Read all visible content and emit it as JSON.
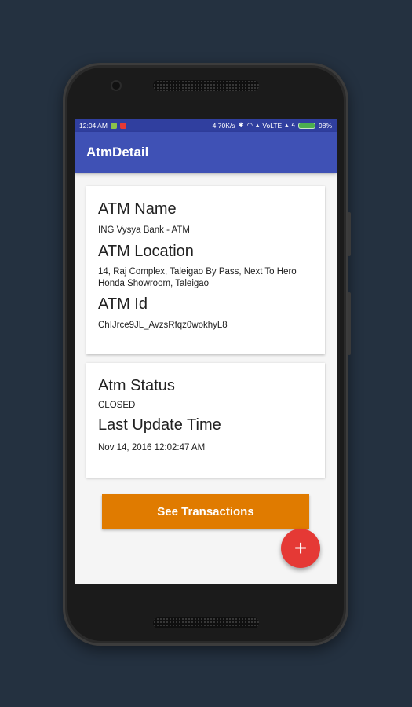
{
  "status_bar": {
    "time": "12:04 AM",
    "speed": "4.70K/s",
    "network": "VoLTE",
    "battery": "98%"
  },
  "app_bar": {
    "title": "AtmDetail"
  },
  "atm_card": {
    "name_heading": "ATM Name",
    "name_value": "ING Vysya Bank - ATM",
    "location_heading": "ATM Location",
    "location_value": "14, Raj Complex, Taleigao By Pass, Next To Hero Honda Showroom, Taleigao",
    "id_heading": "ATM Id",
    "id_value": "ChIJrce9JL_AvzsRfqz0wokhyL8"
  },
  "status_card": {
    "status_heading": "Atm Status",
    "status_value": "CLOSED",
    "update_heading": "Last Update Time",
    "update_value": "Nov 14, 2016 12:02:47 AM"
  },
  "actions": {
    "see_transactions_label": "See Transactions",
    "fab_label": "+"
  },
  "colors": {
    "primary": "#3f51b5",
    "primary_dark": "#303f9f",
    "button": "#e07b00",
    "fab": "#e53935"
  }
}
